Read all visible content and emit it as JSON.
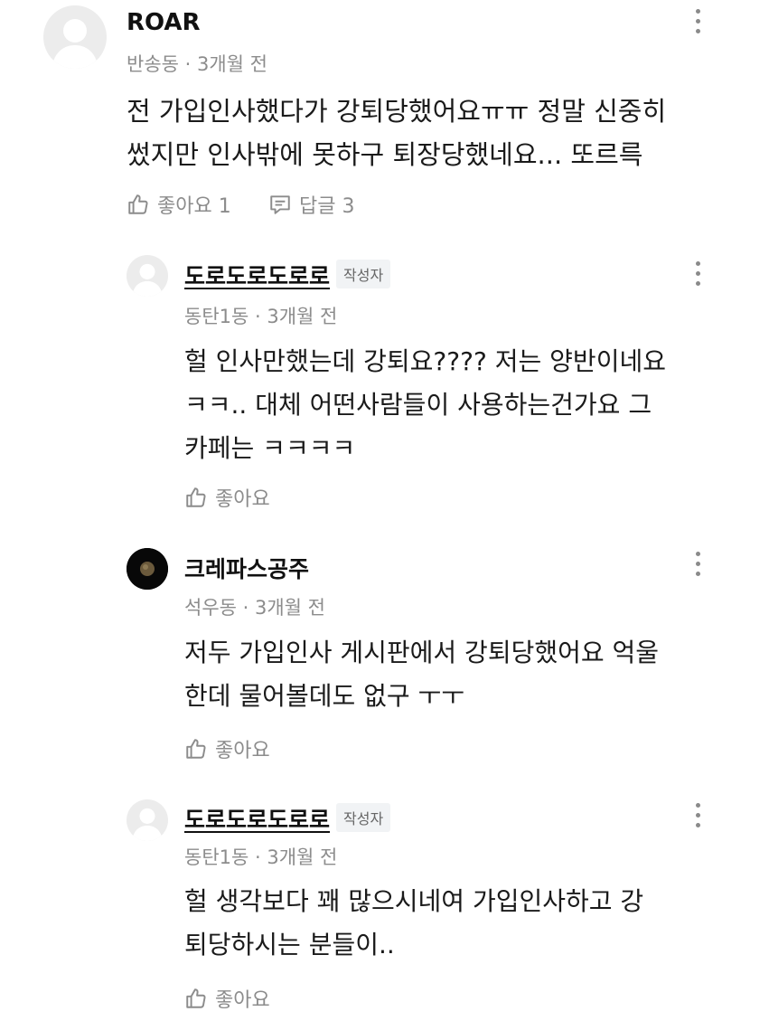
{
  "comments": [
    {
      "author": "ROAR",
      "meta": "반송동 · 3개월 전",
      "lines": [
        "전 가입인사했다가 강퇴당했어요ㅠㅠ 정말 신중히",
        "썼지만 인사밖에 못하구 퇴장당했네요... 또르륵"
      ],
      "like_label": "좋아요 1",
      "reply_label": "답글 3"
    },
    {
      "author": "도로도로도로로",
      "badge": "작성자",
      "meta": "동탄1동 · 3개월 전",
      "lines": [
        "헐 인사만했는데 강퇴요???? 저는 양반이네요",
        "ㅋㅋ.. 대체 어떤사람들이 사용하는건가요 그",
        "카페는 ㅋㅋㅋㅋ"
      ],
      "like_label": "좋아요"
    },
    {
      "author": "크레파스공주",
      "meta": "석우동 · 3개월 전",
      "lines": [
        "저두 가입인사 게시판에서 강퇴당했어요 억울",
        "한데 물어볼데도 없구 ㅜㅜ"
      ],
      "like_label": "좋아요"
    },
    {
      "author": "도로도로도로로",
      "badge": "작성자",
      "meta": "동탄1동 · 3개월 전",
      "lines": [
        "헐 생각보다 꽤 많으시네여 가입인사하고 강",
        "퇴당하시는 분들이.."
      ],
      "like_label": "좋아요"
    }
  ]
}
